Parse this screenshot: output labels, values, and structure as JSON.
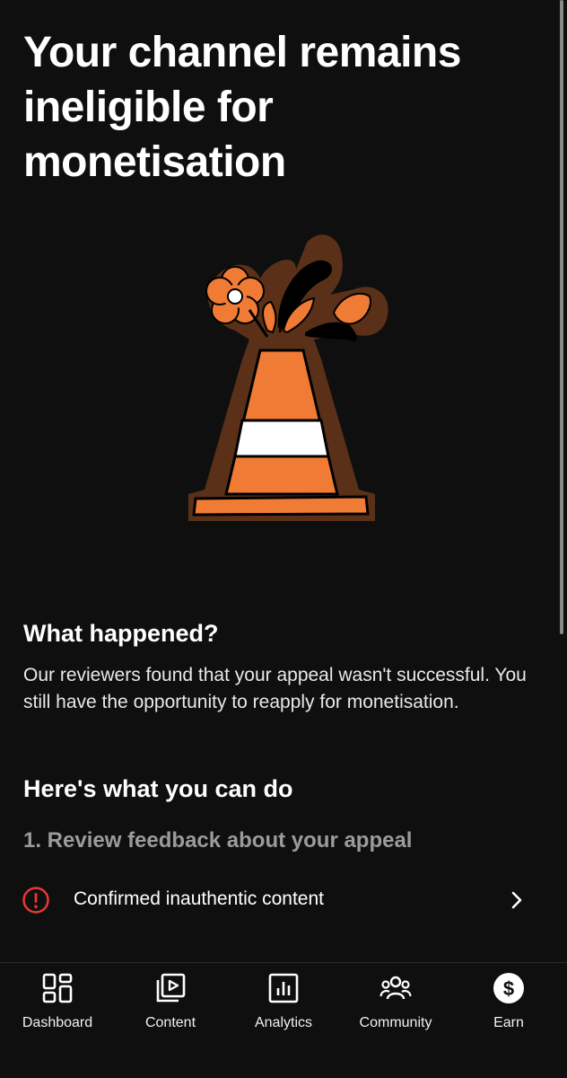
{
  "page": {
    "title": "Your channel remains ineligible for monetisation"
  },
  "what_happened": {
    "heading": "What happened?",
    "body": "Our reviewers found that your appeal wasn't successful. You still have the opportunity to reapply for monetisation."
  },
  "actions": {
    "heading": "Here's what you can do",
    "step1_title": "1. Review feedback about your appeal",
    "feedback_item": {
      "label": "Confirmed inauthentic content",
      "icon": "alert-circle-icon",
      "icon_color": "#e53935"
    }
  },
  "nav": {
    "items": [
      {
        "label": "Dashboard",
        "icon": "dashboard-icon"
      },
      {
        "label": "Content",
        "icon": "content-icon"
      },
      {
        "label": "Analytics",
        "icon": "analytics-icon"
      },
      {
        "label": "Community",
        "icon": "community-icon"
      },
      {
        "label": "Earn",
        "icon": "earn-icon",
        "active": true
      }
    ]
  },
  "colors": {
    "background": "#0f0f0f",
    "cone_orange": "#f07b35",
    "cone_outline": "#6b3a1f",
    "alert_red": "#e53935",
    "muted_text": "#9b9b9b"
  }
}
